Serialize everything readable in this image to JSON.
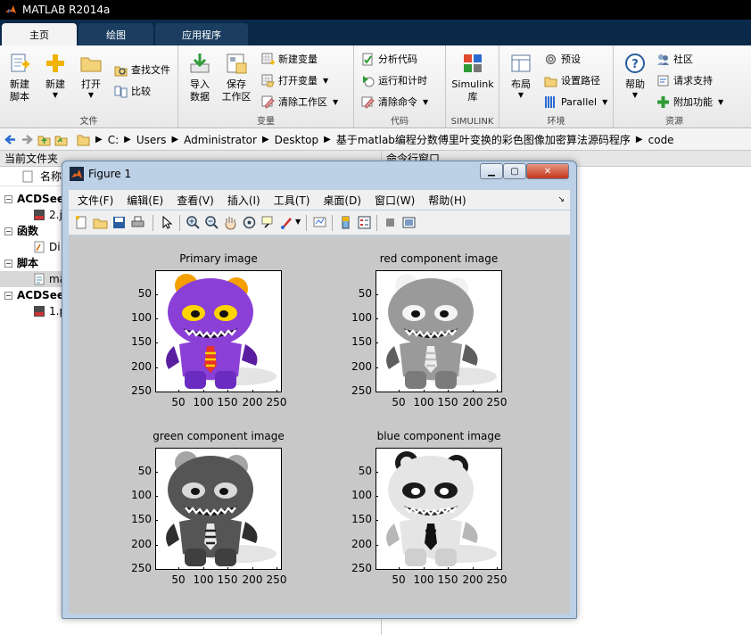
{
  "app": {
    "title": "MATLAB R2014a"
  },
  "tabs": [
    {
      "label": "主页",
      "active": true
    },
    {
      "label": "绘图",
      "active": false
    },
    {
      "label": "应用程序",
      "active": false
    }
  ],
  "ribbon": {
    "file": {
      "footer": "文件",
      "new_script": "新建\n脚本",
      "new": "新建",
      "open": "打开",
      "find_files": "查找文件",
      "compare": "比较"
    },
    "variable": {
      "footer": "变量",
      "import": "导入\n数据",
      "save_ws": "保存\n工作区",
      "new_var": "新建变量",
      "open_var": "打开变量",
      "clear_ws": "清除工作区"
    },
    "code": {
      "footer": "代码",
      "analyze": "分析代码",
      "run_time": "运行和计时",
      "clear_cmd": "清除命令"
    },
    "simulink": {
      "footer": "SIMULINK",
      "lib": "Simulink\n库"
    },
    "env": {
      "footer": "环境",
      "layout": "布局",
      "prefs": "预设",
      "set_path": "设置路径",
      "parallel": "Parallel"
    },
    "resources": {
      "footer": "资源",
      "help": "帮助",
      "community": "社区",
      "request_support": "请求支持",
      "addons": "附加功能"
    }
  },
  "address": {
    "crumbs": [
      "C:",
      "Users",
      "Administrator",
      "Desktop",
      "基于matlab编程分数傅里叶变换的彩色图像加密算法源码程序",
      "code"
    ]
  },
  "left_panel": {
    "header": "当前文件夹",
    "col_name": "名称",
    "rows": [
      {
        "label": "ACDSee",
        "bold": true
      },
      {
        "label": "2.j"
      },
      {
        "label": "函数",
        "bold": true
      },
      {
        "label": "Di"
      },
      {
        "label": "脚本",
        "bold": true
      },
      {
        "label": "ma"
      },
      {
        "label": "ACDSee",
        "bold": true
      },
      {
        "label": "1.p"
      }
    ]
  },
  "right_panel": {
    "header": "命令行窗口"
  },
  "figure": {
    "title": "Figure 1",
    "menus": [
      "文件(F)",
      "编辑(E)",
      "查看(V)",
      "插入(I)",
      "工具(T)",
      "桌面(D)",
      "窗口(W)",
      "帮助(H)"
    ],
    "subplots": [
      {
        "title": "Primary image",
        "variant": "color"
      },
      {
        "title": "red component image",
        "variant": "red"
      },
      {
        "title": "green component image",
        "variant": "green"
      },
      {
        "title": "blue component image",
        "variant": "blue"
      }
    ],
    "yticks": [
      "50",
      "100",
      "150",
      "200",
      "250"
    ],
    "xticks": [
      "50",
      "100",
      "150",
      "200",
      "250"
    ]
  },
  "colors": {
    "titlebar": "#000000",
    "tab_strip": "#0b2a4a",
    "figure_bg": "#c8c8c8",
    "purple": "#8a3fd6",
    "orange": "#f5a000"
  }
}
